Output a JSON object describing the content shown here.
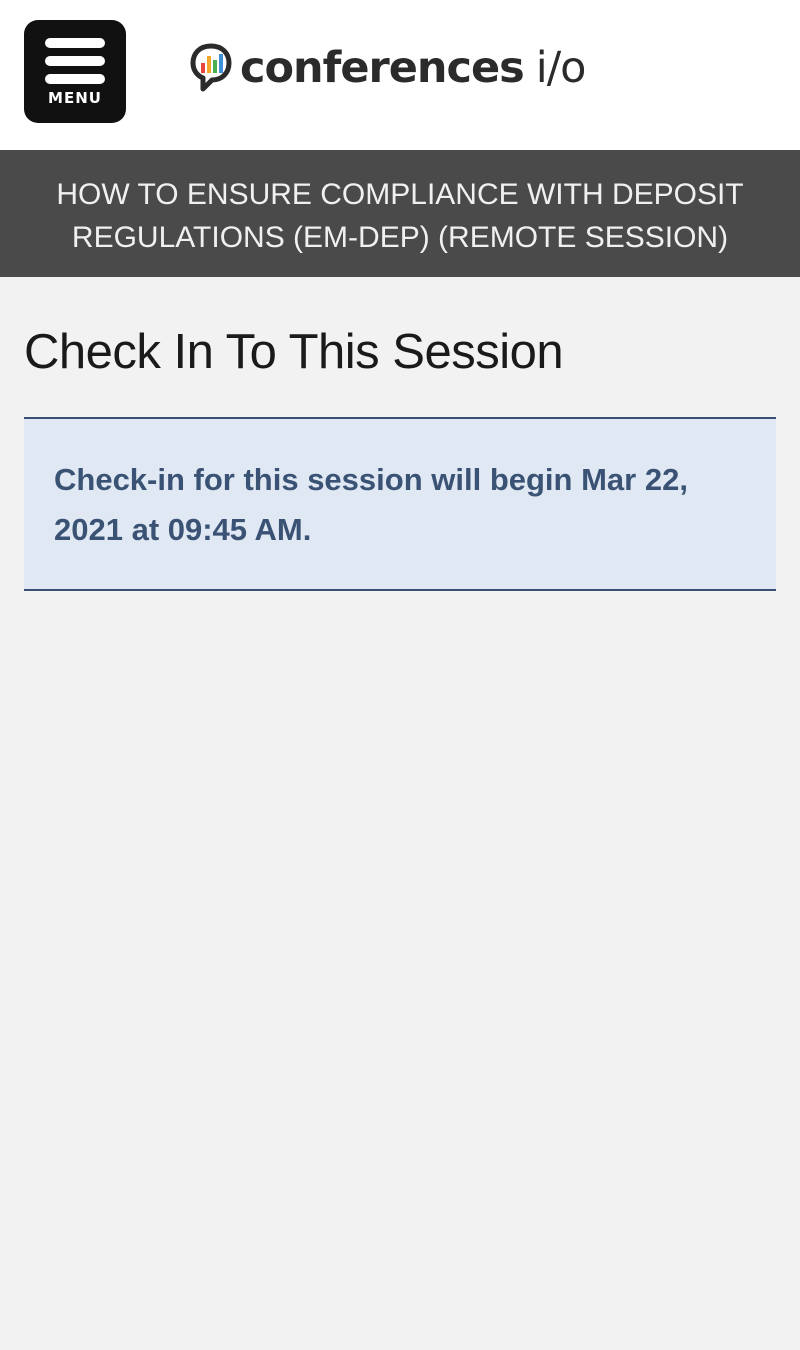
{
  "header": {
    "menu_label": "MENU",
    "logo_word": "conferences",
    "logo_suffix": "i/o"
  },
  "session": {
    "title": "HOW TO ENSURE COMPLIANCE WITH DEPOSIT REGULATIONS (EM-DEP) (REMOTE SESSION)"
  },
  "main": {
    "page_title": "Check In To This Session",
    "notice": "Check-in for this session will begin Mar 22, 2021 at 09:45 AM."
  },
  "colors": {
    "menu_bg": "#111111",
    "banner_bg": "#4a4a4a",
    "notice_bg": "#e0e8f3",
    "notice_text": "#3a5274",
    "page_bg": "#f2f2f2"
  }
}
